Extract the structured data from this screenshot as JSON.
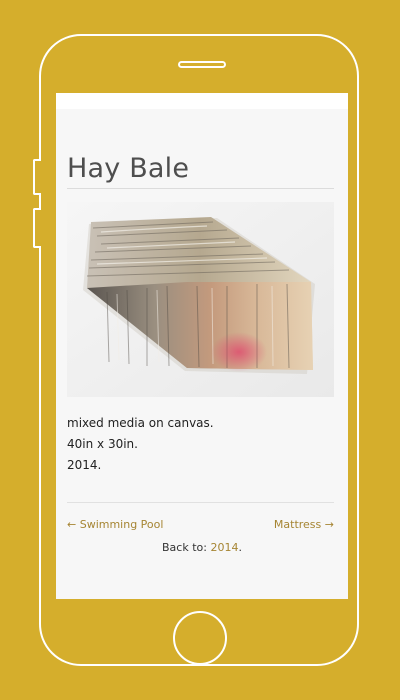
{
  "page": {
    "title": "Hay Bale"
  },
  "artwork": {
    "alt": "Hay Bale"
  },
  "details": {
    "medium": "mixed media on canvas.",
    "dimensions": "40in x 30in.",
    "year": "2014."
  },
  "navigation": {
    "previous_label": "← Swimming Pool",
    "next_label": "Mattress →",
    "back_prefix": "Back to: ",
    "back_link": "2014",
    "back_suffix": "."
  },
  "colors": {
    "background": "#d5ae2c",
    "phone_outline": "#ffffff",
    "screen": "#f7f7f7",
    "link": "#a68533",
    "title": "#4e4e4e"
  }
}
